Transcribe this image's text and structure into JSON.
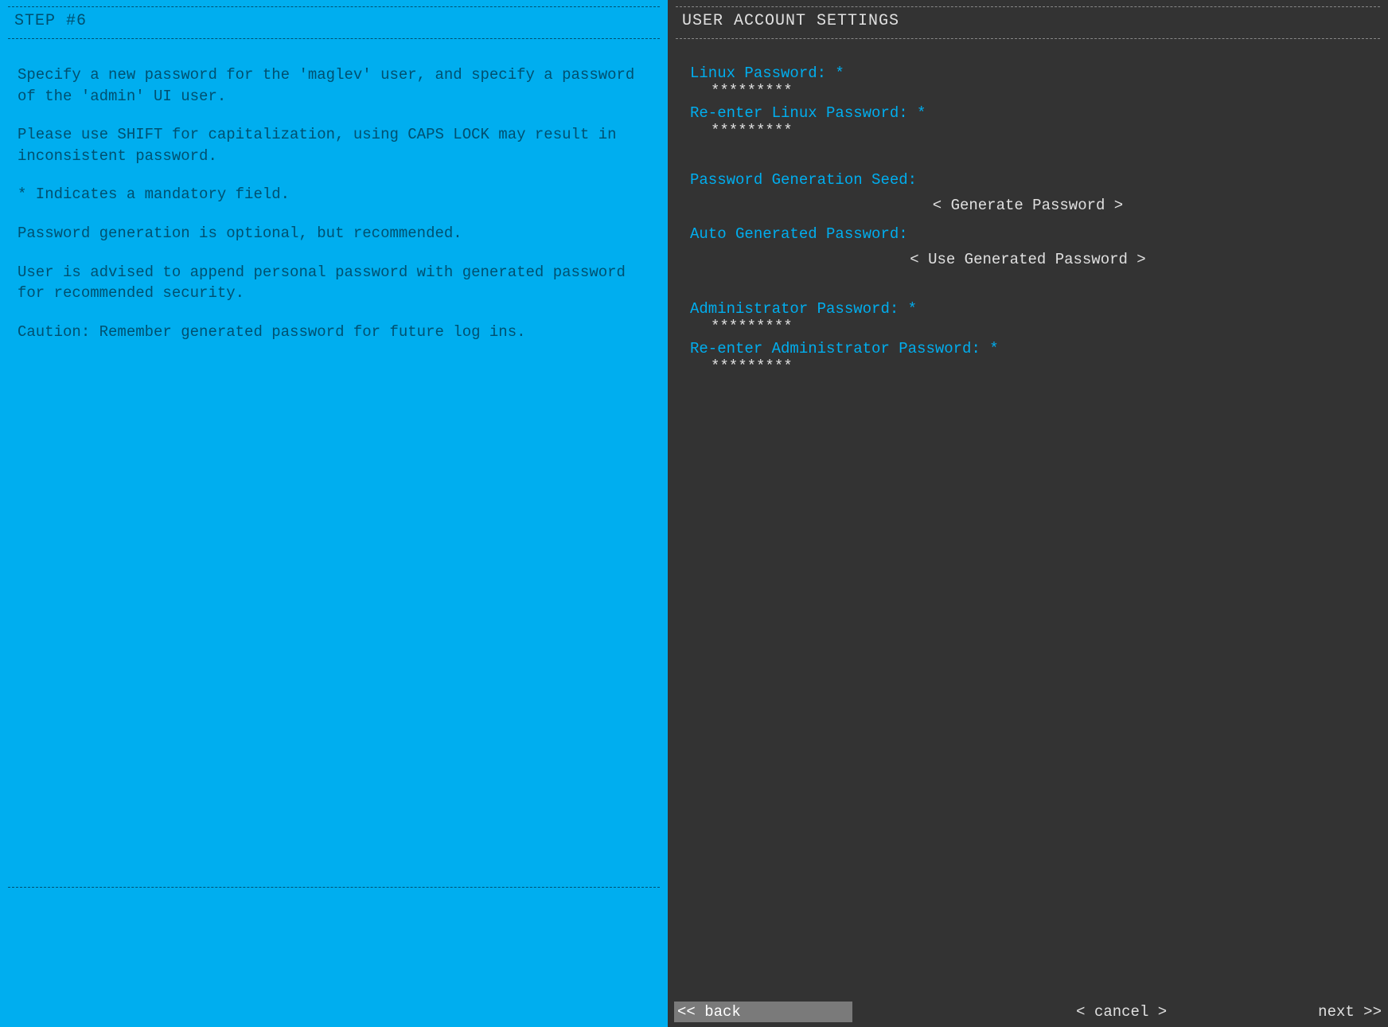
{
  "left": {
    "title": "STEP #6",
    "paragraphs": [
      "Specify a new password for the 'maglev' user, and specify a password of the 'admin' UI user.",
      "Please use SHIFT for capitalization, using CAPS LOCK may result in inconsistent password.",
      "* Indicates a mandatory field.",
      "Password generation is optional, but recommended.",
      "User is advised to append personal password with generated password for recommended security.",
      "Caution: Remember generated password for future log ins."
    ]
  },
  "right": {
    "title": "USER ACCOUNT SETTINGS",
    "fields": {
      "linux_pw_label": "Linux Password: *",
      "linux_pw_value": "*********",
      "linux_pw2_label": "Re-enter Linux Password: *",
      "linux_pw2_value": "*********",
      "seed_label": "Password Generation Seed:",
      "generate_btn": "< Generate Password >",
      "auto_label": "Auto Generated Password:",
      "use_btn": "< Use Generated Password >",
      "admin_pw_label": "Administrator Password: *",
      "admin_pw_value": "*********",
      "admin_pw2_label": "Re-enter Administrator Password: *",
      "admin_pw2_value": "*********"
    }
  },
  "footer": {
    "back": "<< back",
    "cancel": "< cancel >",
    "next": "next >>"
  }
}
